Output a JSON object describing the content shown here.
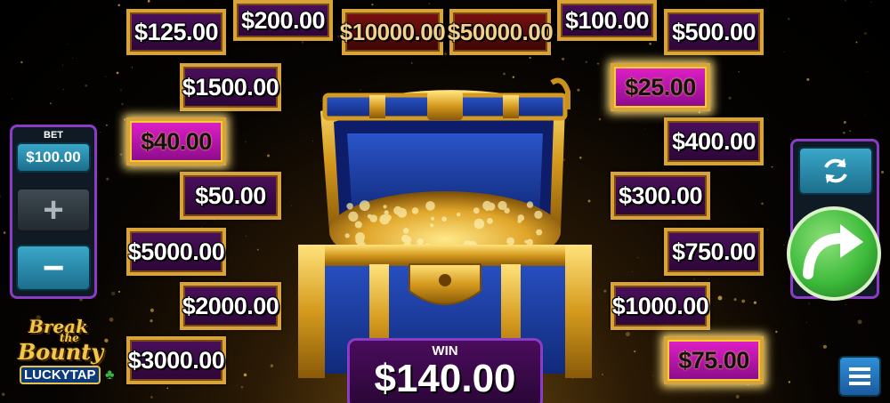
{
  "prizes": {
    "p1": "$125.00",
    "p2": "$200.00",
    "p3": "$10000.00",
    "p4": "$50000.00",
    "p5": "$100.00",
    "p6": "$500.00",
    "p7": "$1500.00",
    "p8": "$25.00",
    "p9": "$40.00",
    "p10": "$400.00",
    "p11": "$50.00",
    "p12": "$300.00",
    "p13": "$5000.00",
    "p14": "$750.00",
    "p15": "$2000.00",
    "p16": "$1000.00",
    "p17": "$3000.00",
    "p18": "$75.00"
  },
  "bet": {
    "label": "BET",
    "value": "$100.00",
    "plus": "+",
    "minus": "−"
  },
  "win": {
    "label": "WIN",
    "value": "$140.00"
  },
  "logo": {
    "line1": "Break",
    "line2": "the",
    "line3": "Bounty",
    "line4": "LUCKYTAP"
  },
  "icons": {
    "refresh": "refresh-icon",
    "spin": "curved-arrow-icon",
    "menu": "hamburger-menu-icon"
  },
  "colors": {
    "frame_gold": "#d7a33a",
    "tile_purple": "#3b0a4a",
    "highlight_magenta": "#c81cbd",
    "panel_border": "#8a3cc6",
    "spin_green": "#3dbb3b"
  }
}
